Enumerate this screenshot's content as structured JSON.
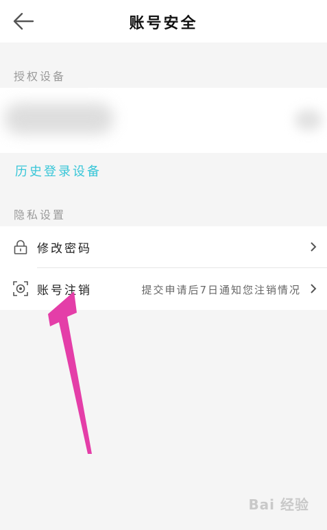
{
  "header": {
    "title": "账号安全",
    "back_icon": "arrow-left-icon"
  },
  "sections": {
    "authorized_devices": "授权设备",
    "history_link": "历史登录设备",
    "privacy": "隐私设置"
  },
  "rows": [
    {
      "label": "修改密码",
      "sub": "",
      "icon": "lock-icon"
    },
    {
      "label": "账号注销",
      "sub": "提交申请后7日通知您注销情况",
      "icon": "face-scan-icon"
    }
  ],
  "watermark": {
    "text": "Bai 经验"
  },
  "colors": {
    "accent": "#38c6d8",
    "annotation_arrow": "#e43ea8",
    "background": "#f5f5f5",
    "card": "#ffffff"
  }
}
